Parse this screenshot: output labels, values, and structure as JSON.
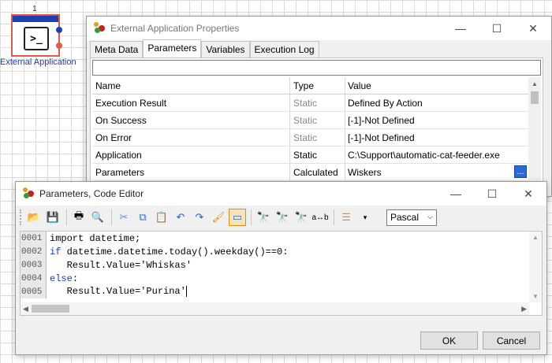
{
  "canvas": {
    "node_number": "1",
    "node_label": "External Application",
    "node_icon": "terminal-icon"
  },
  "props_window": {
    "title": "External Application Properties",
    "tabs": [
      {
        "label": "Meta Data"
      },
      {
        "label": "Parameters"
      },
      {
        "label": "Variables"
      },
      {
        "label": "Execution Log"
      }
    ],
    "active_tab": "Parameters",
    "columns": {
      "name": "Name",
      "type": "Type",
      "value": "Value"
    },
    "rows": [
      {
        "name": "Execution Result",
        "type": "Static",
        "value": "Defined By Action"
      },
      {
        "name": "On Success",
        "type": "Static",
        "value": "[-1]-Not Defined"
      },
      {
        "name": "On Error",
        "type": "Static",
        "value": "[-1]-Not Defined"
      },
      {
        "name": "Application",
        "type": "Static",
        "value": "C:\\Support\\automatic-cat-feeder.exe"
      },
      {
        "name": "Parameters",
        "type": "Calculated",
        "value": "Wiskers"
      }
    ],
    "ellipsis_label": "..."
  },
  "editor_window": {
    "title": "Parameters, Code Editor",
    "language": "Pascal",
    "lines": [
      {
        "num": "0001",
        "pre": "",
        "kw": "",
        "text": "import datetime;"
      },
      {
        "num": "0002",
        "pre": "",
        "kw": "if",
        "text": " datetime.datetime.today().weekday()==0:"
      },
      {
        "num": "0003",
        "pre": "   ",
        "kw": "",
        "text": "Result.Value='Whiskas'"
      },
      {
        "num": "0004",
        "pre": "",
        "kw": "else",
        "text": ":"
      },
      {
        "num": "0005",
        "pre": "   ",
        "kw": "",
        "text": "Result.Value='Purina'"
      }
    ],
    "ok_label": "OK",
    "cancel_label": "Cancel"
  },
  "window_controls": {
    "minimize": "—",
    "maximize": "☐",
    "close": "✕"
  }
}
